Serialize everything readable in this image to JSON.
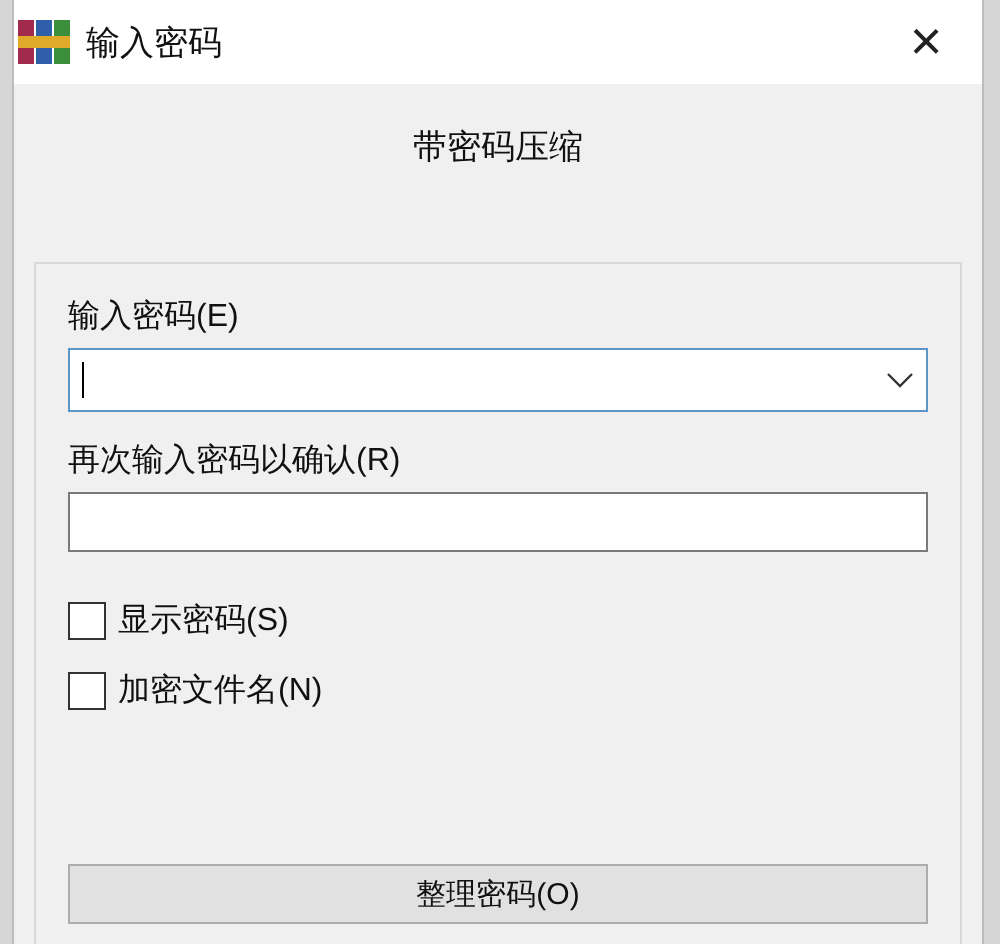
{
  "window": {
    "title": "输入密码",
    "close": "×"
  },
  "heading": "带密码压缩",
  "password": {
    "label": "输入密码(E)",
    "focused": true,
    "expanded": false
  },
  "confirm": {
    "label": "再次输入密码以确认(R)"
  },
  "options": [
    {
      "label": "显示密码(S)",
      "checked": false
    },
    {
      "label": "加密文件名(N)",
      "checked": false
    }
  ],
  "button": "整理密码(O)"
}
